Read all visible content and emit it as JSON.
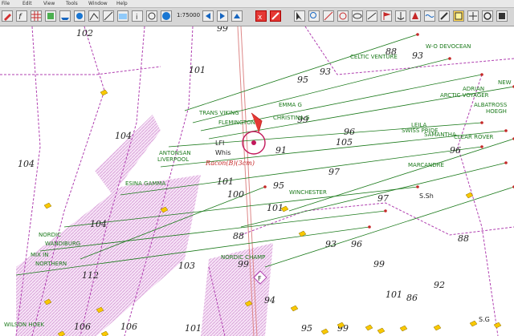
{
  "menubar": {
    "items": [
      "File",
      "Edit",
      "View",
      "Tools",
      "Window",
      "Help"
    ]
  },
  "toolbar": {
    "zoom_label": "1:75000"
  },
  "chart": {
    "depths": [
      {
        "v": "102"
      },
      {
        "v": "99"
      },
      {
        "v": "101"
      },
      {
        "v": "104"
      },
      {
        "v": "104"
      },
      {
        "v": "101"
      },
      {
        "v": "100"
      },
      {
        "v": "95"
      },
      {
        "v": "99"
      },
      {
        "v": "95"
      },
      {
        "v": "97"
      },
      {
        "v": "105"
      },
      {
        "v": "96"
      },
      {
        "v": "93"
      },
      {
        "v": "97"
      },
      {
        "v": "88"
      },
      {
        "v": "93"
      },
      {
        "v": "96"
      },
      {
        "v": "88"
      },
      {
        "v": "93"
      },
      {
        "v": "99"
      },
      {
        "v": "94"
      },
      {
        "v": "101"
      },
      {
        "v": "103"
      },
      {
        "v": "112"
      },
      {
        "v": "104"
      },
      {
        "v": "106"
      },
      {
        "v": "106"
      },
      {
        "v": "101"
      },
      {
        "v": "95"
      },
      {
        "v": "99"
      },
      {
        "v": "96"
      },
      {
        "v": "86"
      },
      {
        "v": "92"
      },
      {
        "v": "88"
      },
      {
        "v": "99"
      },
      {
        "v": "101"
      },
      {
        "v": "91"
      }
    ],
    "vessels": [
      {
        "name": "TRANS VIKING"
      },
      {
        "name": "FLEMINGTON"
      },
      {
        "name": "CHRISTINA G"
      },
      {
        "name": "ANTONSAN"
      },
      {
        "name": "LIVERPOOL"
      },
      {
        "name": "CELTIC VENTURE"
      },
      {
        "name": "W-O DEVOCEAN"
      },
      {
        "name": "ARCTIC VOYAGER"
      },
      {
        "name": "ADRIAN"
      },
      {
        "name": "ALBATROSS"
      },
      {
        "name": "HOEGH"
      },
      {
        "name": "LEILA"
      },
      {
        "name": "CLEAR ROVER"
      },
      {
        "name": "MARCANDRE"
      },
      {
        "name": "ESINA GAMMA"
      },
      {
        "name": "NORDIC"
      },
      {
        "name": "WANDIBURG"
      },
      {
        "name": "MIX IN"
      },
      {
        "name": "NORTHERN"
      },
      {
        "name": "NORDIC CHAMP"
      },
      {
        "name": "WILSON HOEK"
      },
      {
        "name": "EMMA G"
      },
      {
        "name": "WINCHESTER"
      },
      {
        "name": "SWISS PRIDE"
      },
      {
        "name": "SAMANTHA"
      },
      {
        "name": "NEW"
      }
    ],
    "light": {
      "name": "LFI",
      "char": "Whis",
      "racon": "Racon(B)(3cm)"
    },
    "s_sh": "S.Sh",
    "s_g": "S.G",
    "wreck": "F"
  },
  "colors": {
    "land_pattern": "#e5b8e5",
    "zone_line": "#b03fb0",
    "vessel": "#1b7a1b",
    "own_ship": "#c2185b",
    "track": "#c62828"
  }
}
